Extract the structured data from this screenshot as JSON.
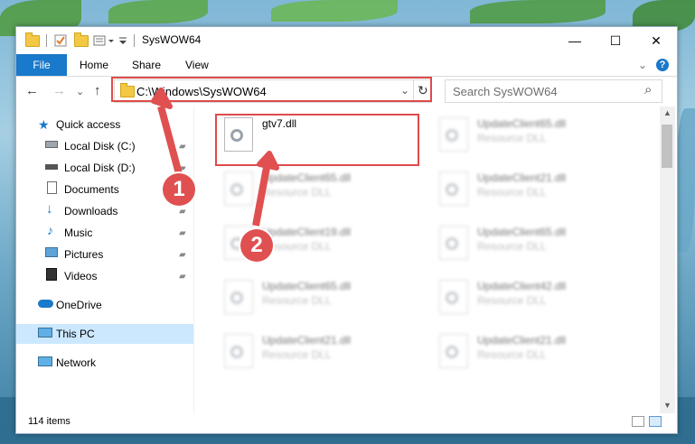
{
  "window": {
    "title": "SysWOW64",
    "minimize": "—",
    "maximize": "☐",
    "close": "✕"
  },
  "ribbon": {
    "tabs": [
      "File",
      "Home",
      "Share",
      "View"
    ],
    "collapse": "⌄",
    "help": "?"
  },
  "nav": {
    "back": "←",
    "forward": "→",
    "recent": "⌄",
    "up": "↑",
    "address": "C:\\Windows\\SysWOW64",
    "address_dropdown": "⌄",
    "refresh": "↻",
    "search_placeholder": "Search SysWOW64",
    "search_icon": "⌕"
  },
  "sidebar": {
    "items": [
      {
        "label": "Quick access",
        "icon": "star-icon",
        "pinned": false
      },
      {
        "label": "Local Disk (C:)",
        "icon": "drive-icon",
        "pinned": true
      },
      {
        "label": "Local Disk (D:)",
        "icon": "drive-icon",
        "pinned": true
      },
      {
        "label": "Documents",
        "icon": "documents-icon",
        "pinned": true
      },
      {
        "label": "Downloads",
        "icon": "downloads-icon",
        "pinned": true
      },
      {
        "label": "Music",
        "icon": "music-icon",
        "pinned": true
      },
      {
        "label": "Pictures",
        "icon": "pictures-icon",
        "pinned": true
      },
      {
        "label": "Videos",
        "icon": "videos-icon",
        "pinned": true
      },
      {
        "label": "OneDrive",
        "icon": "cloud-icon",
        "pinned": false
      },
      {
        "label": "This PC",
        "icon": "computer-icon",
        "pinned": false
      },
      {
        "label": "Network",
        "icon": "network-icon",
        "pinned": false
      }
    ],
    "pin_glyph": "📌"
  },
  "files": [
    {
      "name": "gtv7.dll",
      "type": ""
    },
    {
      "name": "UpdateClient65.dll",
      "type": "Resource DLL"
    },
    {
      "name": "UpdateClient65.dll",
      "type": "Resource DLL"
    },
    {
      "name": "UpdateClient21.dll",
      "type": "Resource DLL"
    },
    {
      "name": "UpdateClient19.dll",
      "type": "Resource DLL"
    },
    {
      "name": "UpdateClient65.dll",
      "type": "Resource DLL"
    },
    {
      "name": "UpdateClient65.dll",
      "type": "Resource DLL"
    },
    {
      "name": "UpdateClient42.dll",
      "type": "Resource DLL"
    },
    {
      "name": "UpdateClient21.dll",
      "type": "Resource DLL"
    },
    {
      "name": "UpdateClient21.dll",
      "type": "Resource DLL"
    }
  ],
  "status": {
    "item_count": "114 items"
  },
  "callouts": [
    "1",
    "2"
  ],
  "colors": {
    "accent": "#1979ca",
    "highlight": "#e04a4a",
    "selected_nav": "#cce8ff"
  }
}
